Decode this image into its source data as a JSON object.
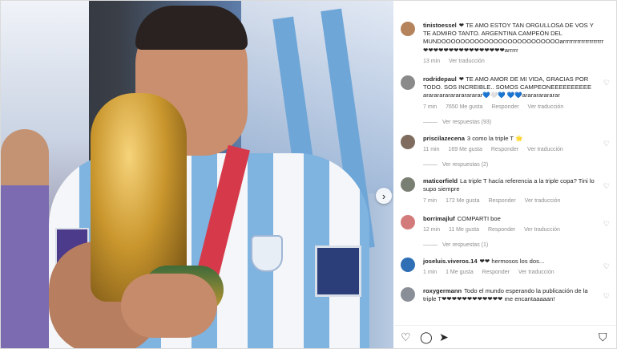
{
  "comments": [
    {
      "user": "tinistoessel",
      "text": "❤ TE AMO ESTOY TAN ORGULLOSA DE VOS Y TE ADMIRO TANTO. ARGENTINA CAMPEÓN DEL MUNDOOOOOOOOOOOOOOOOOOOOOOOOOarrrrrrrrrrrrrrrrrrrr❤❤❤❤❤❤❤❤❤❤❤❤❤❤❤❤arrrrr",
      "time": "13 min",
      "likes": "",
      "reply": "Ver traducción",
      "avatar_color": "#b5845d"
    },
    {
      "user": "rodridepaul",
      "text": "❤ TE AMO AMOR DE MI VIDA, GRACIAS POR TODO. SOS INCREIBLE.. SOMOS CAMPEONEEEEEEEEEE ararararararararararar💙🤍💙 💙💙ararararararar",
      "time": "7 min",
      "likes": "7650 Me gusta",
      "reply": "Responder",
      "translate": "Ver traducción",
      "avatar_color": "#8a8a8a"
    },
    {
      "user": "priscilazecena",
      "text": "3 como la triple T 🌟",
      "time": "11 min",
      "likes": "169 Me gusta",
      "reply": "Responder",
      "translate": "Ver traducción",
      "avatar_color": "#7f6c5e"
    },
    {
      "user": "maticorfield",
      "text": "La triple T hacía referencia a la triple copa? Tini lo supo siempre",
      "time": "7 min",
      "likes": "172 Me gusta",
      "reply": "Responder",
      "translate": "Ver traducción",
      "avatar_color": "#7a7f74"
    },
    {
      "user": "borrimajluf",
      "text": "COMPARTI boe",
      "time": "12 min",
      "likes": "11 Me gusta",
      "reply": "Responder",
      "translate": "Ver traducción",
      "avatar_color": "#d37b7b"
    },
    {
      "user": "joseluis.viveros.14",
      "text": "❤❤ hermosos los dos...",
      "time": "1 min",
      "likes": "1 Me gusta",
      "reply": "Responder",
      "translate": "Ver traducción",
      "avatar_color": "#2f6fb5"
    },
    {
      "user": "roxygermann",
      "text": "Todo el mundo esperando la publicación de la triple T❤❤❤❤❤❤❤❤❤❤❤❤ me encantaaaaan!",
      "time": "",
      "likes": "",
      "reply": "",
      "avatar_color": "#8a8f97"
    }
  ],
  "replies": [
    {
      "label": "Ver respuestas (93)"
    },
    {
      "label": "Ver respuestas (2)"
    },
    {
      "label": "Ver respuestas (1)"
    }
  ],
  "icons": {
    "heart": "heart-icon",
    "comment": "comment-icon",
    "share": "share-icon",
    "save": "bookmark-icon",
    "next": "chevron-right-icon"
  },
  "colors": {
    "link_text": "#262626",
    "meta_text": "#8e8e8e",
    "heart_red": "#ed1c24"
  }
}
